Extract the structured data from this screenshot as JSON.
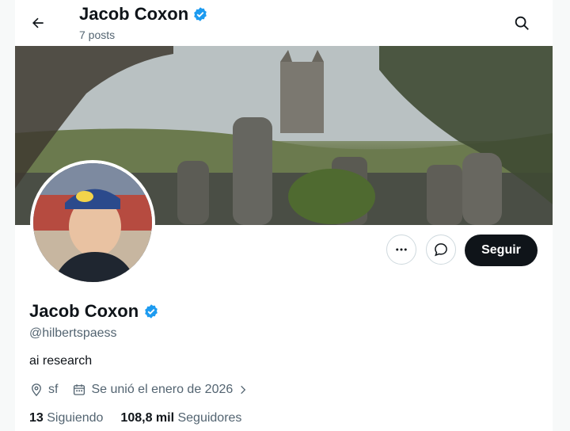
{
  "header": {
    "name": "Jacob Coxon",
    "posts": "7 posts"
  },
  "profile": {
    "name": "Jacob Coxon",
    "handle": "@hilbertspaess",
    "bio": "ai research",
    "location": "sf",
    "joined": "Se unió el enero de 2026",
    "following_count": "13",
    "following_label": "Siguiendo",
    "followers_count": "108,8 mil",
    "followers_label": "Seguidores"
  },
  "actions": {
    "follow_label": "Seguir"
  },
  "colors": {
    "verified": "#1d9bf0",
    "text": "#0f1419",
    "secondary": "#536471",
    "follow_bg": "#0f1419"
  },
  "icons": [
    "back-arrow-icon",
    "verified-badge-icon",
    "search-icon",
    "more-icon",
    "message-icon",
    "location-icon",
    "calendar-icon",
    "chevron-right-icon"
  ]
}
